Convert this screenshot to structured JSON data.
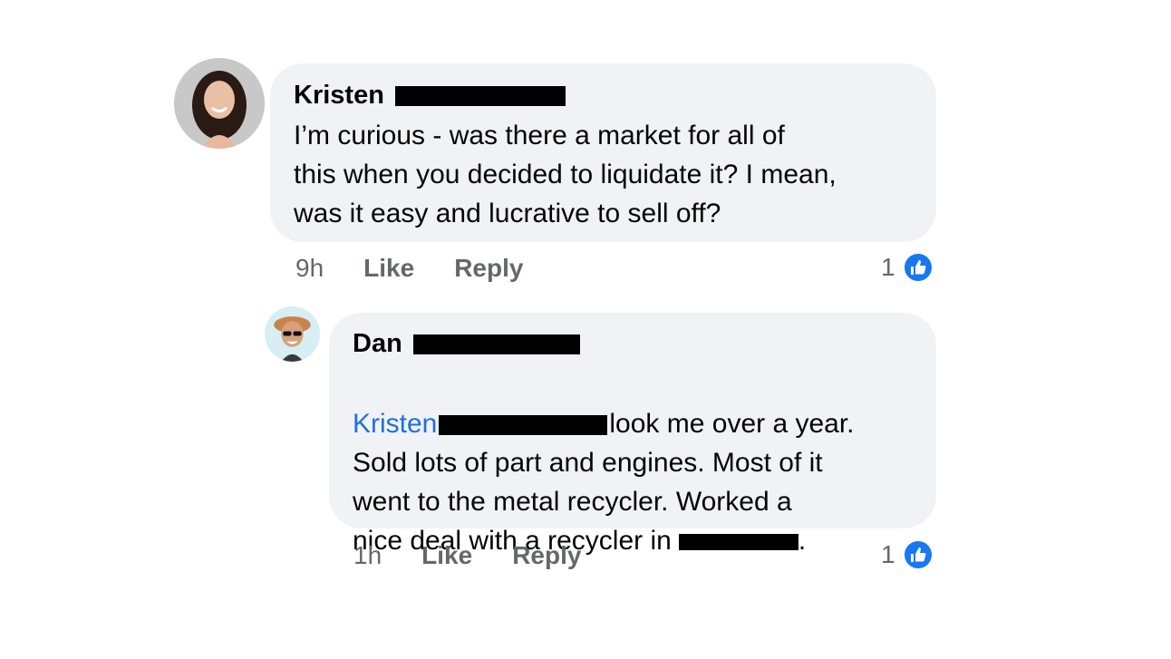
{
  "comments": [
    {
      "author": "Kristen",
      "text_lines": "I’m curious - was there a market for all of\nthis when you decided to liquidate it? I mean,\nwas it easy and lucrative to sell off?",
      "time": "9h",
      "like_label": "Like",
      "reply_label": "Reply",
      "reaction_count": "1",
      "reaction_icon": "like-icon"
    },
    {
      "author": "Dan",
      "mention": "Kristen",
      "text_line1_tail": "look me over a year.",
      "text_rest": "Sold lots of part and engines.  Most of it\nwent to the metal recycler. Worked a\nnice deal with a recycler in",
      "text_end": ".",
      "time": "1h",
      "like_label": "Like",
      "reply_label": "Reply",
      "reaction_count": "1",
      "reaction_icon": "like-icon"
    }
  ],
  "colors": {
    "bubble": "#f0f2f5",
    "mention": "#216fdb",
    "meta": "#65676b",
    "like_badge": "#1877f2"
  }
}
